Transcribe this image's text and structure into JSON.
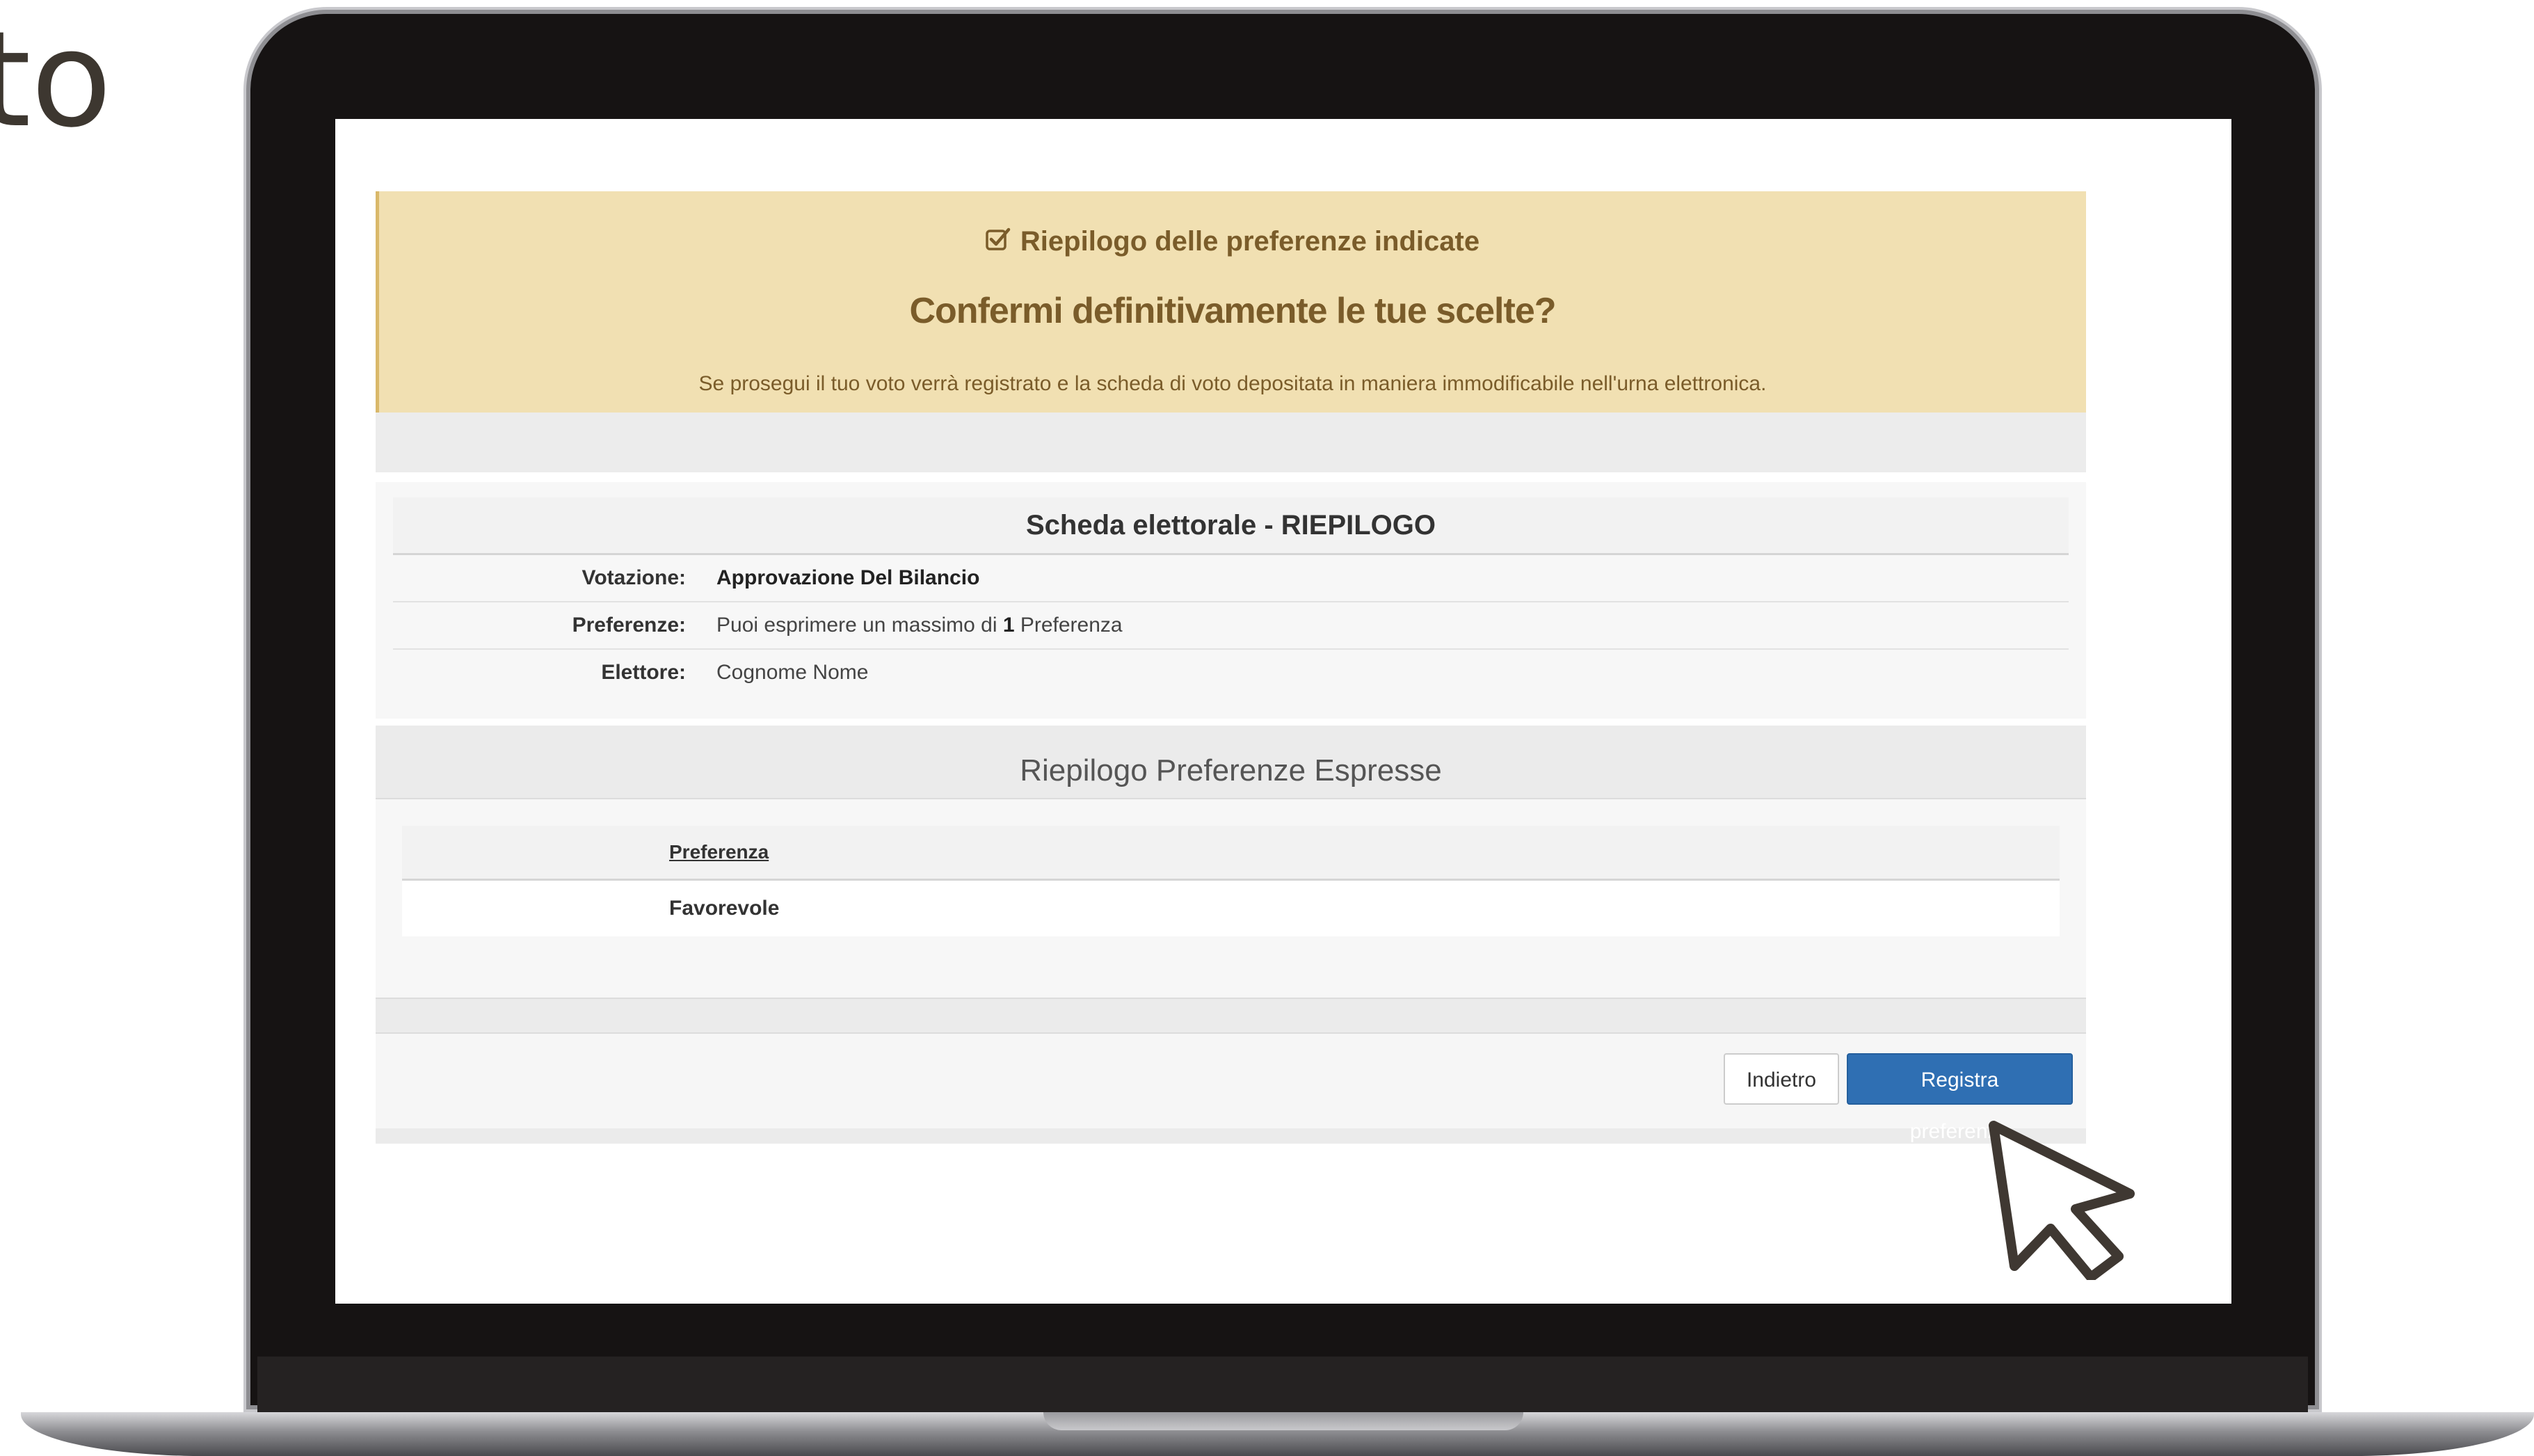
{
  "background_text": "to",
  "alert": {
    "header": "Riepilogo delle preferenze indicate",
    "title": "Confermi definitivamente le tue scelte?",
    "text": "Se prosegui il tuo voto verrà registrato e la scheda di voto depositata in maniera immodificabile nell'urna elettronica."
  },
  "scheda": {
    "title": "Scheda elettorale - RIEPILOGO",
    "rows": [
      {
        "label": "Votazione:",
        "value": "Approvazione Del Bilancio"
      },
      {
        "label": "Preferenze:",
        "value_prefix": "Puoi esprimere un massimo di ",
        "value_count": "1",
        "value_suffix": " Preferenza"
      },
      {
        "label": "Elettore:",
        "value": "Cognome Nome"
      }
    ]
  },
  "preferences": {
    "section_title": "Riepilogo Preferenze Espresse",
    "column_header": "Preferenza",
    "rows": [
      "Favorevole"
    ]
  },
  "buttons": {
    "back": "Indietro",
    "submit": "Registra preferenze"
  },
  "colors": {
    "alert_bg": "#f1e0b2",
    "alert_text": "#7a5c2a",
    "primary_button": "#2f6fb3"
  },
  "icons": [
    "check-square-icon",
    "mouse-pointer-icon"
  ]
}
